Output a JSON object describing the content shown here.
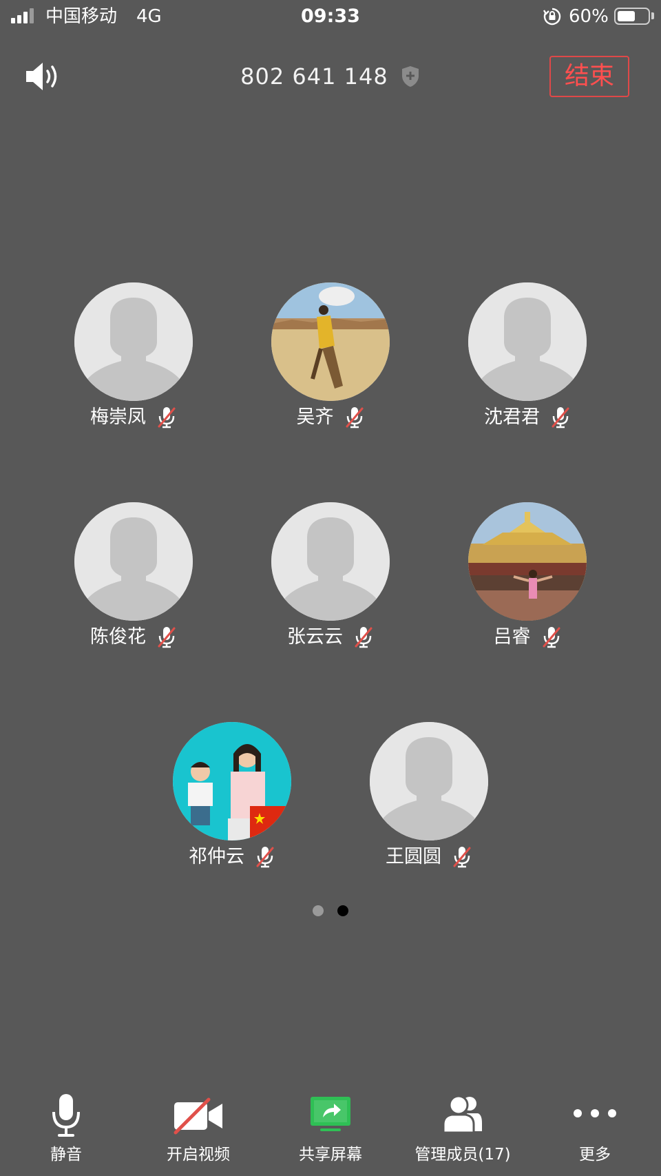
{
  "status_bar": {
    "carrier": "中国移动",
    "network": "4G",
    "time": "09:33",
    "battery_percent": "60%",
    "battery_level": 0.6
  },
  "header": {
    "meeting_id": "802 641 148",
    "end_label": "结束"
  },
  "participants": [
    {
      "name": "梅崇凤",
      "avatar": "default",
      "mic": "muted"
    },
    {
      "name": "吴齐",
      "avatar": "photo",
      "mic": "muted"
    },
    {
      "name": "沈君君",
      "avatar": "default",
      "mic": "muted"
    },
    {
      "name": "陈俊花",
      "avatar": "default",
      "mic": "muted"
    },
    {
      "name": "张云云",
      "avatar": "default",
      "mic": "muted"
    },
    {
      "name": "吕睿",
      "avatar": "photo",
      "mic": "muted"
    },
    {
      "name": "祁仲云",
      "avatar": "photo",
      "mic": "muted"
    },
    {
      "name": "王圆圆",
      "avatar": "default",
      "mic": "muted"
    }
  ],
  "pagination": {
    "pages": 2,
    "current": 2
  },
  "toolbar": {
    "mute_label": "静音",
    "video_label": "开启视频",
    "share_label": "共享屏幕",
    "members_label": "管理成员(17)",
    "more_label": "更多"
  },
  "colors": {
    "background": "#585858",
    "end_red": "#e04848",
    "share_green": "#2fbf55",
    "muted_red": "#e0504a"
  },
  "icons": [
    "signal-icon",
    "orientation-lock-icon",
    "battery-icon",
    "speaker-icon",
    "shield-icon",
    "mic-muted-icon",
    "microphone-icon",
    "video-off-icon",
    "share-screen-icon",
    "members-icon",
    "more-icon"
  ]
}
